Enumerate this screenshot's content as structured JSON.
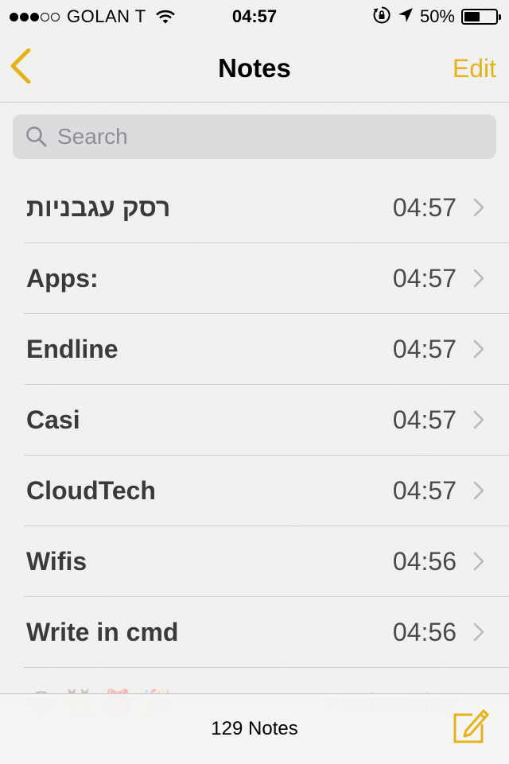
{
  "status_bar": {
    "carrier": "GOLAN T",
    "time": "04:57",
    "battery": "50%",
    "battery_level": 0.5,
    "signal_bars": 3,
    "signal_total": 5
  },
  "nav": {
    "back_icon": "chevron-left-icon",
    "title": "Notes",
    "edit_label": "Edit",
    "accent_color": "#e6b21c"
  },
  "search": {
    "placeholder": "Search",
    "value": ""
  },
  "notes": [
    {
      "title": "רסק עגבניות",
      "time": "04:57"
    },
    {
      "title": "Apps:",
      "time": "04:57"
    },
    {
      "title": "Endline",
      "time": "04:57"
    },
    {
      "title": "Casi",
      "time": "04:57"
    },
    {
      "title": "CloudTech",
      "time": "04:57"
    },
    {
      "title": "Wifis",
      "time": "04:56"
    },
    {
      "title": "Write in cmd",
      "time": "04:56"
    },
    {
      "title": "😂 👯 🎁 🎉",
      "time": "Wednesday"
    }
  ],
  "toolbar": {
    "count_label": "129 Notes",
    "compose_icon": "compose-icon"
  }
}
